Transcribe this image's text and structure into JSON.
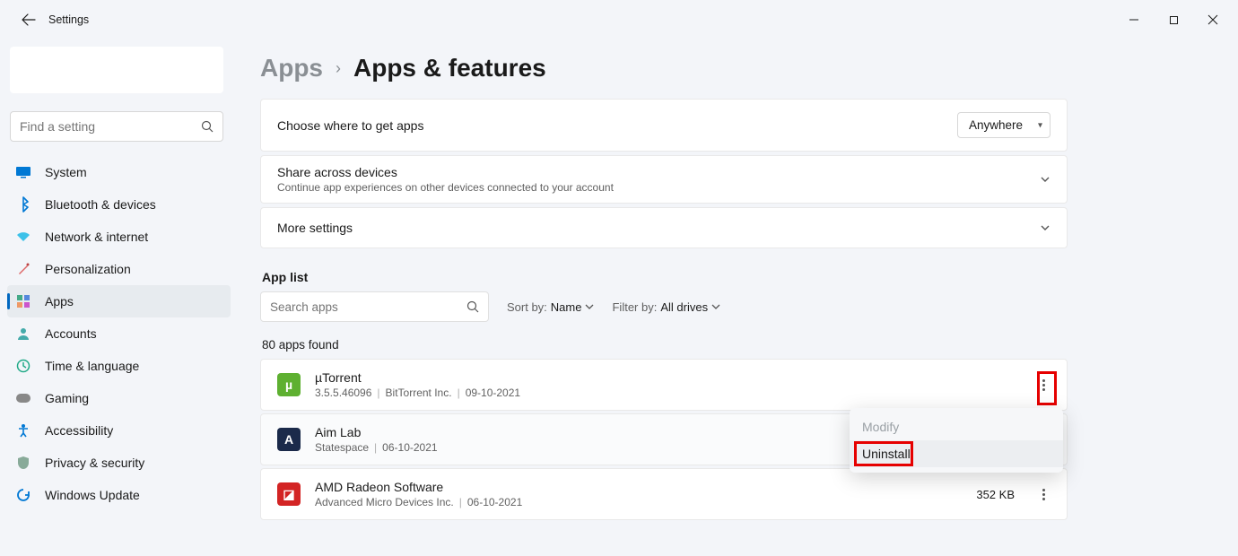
{
  "titlebar": {
    "title": "Settings"
  },
  "search": {
    "placeholder": "Find a setting"
  },
  "nav": [
    {
      "label": "System"
    },
    {
      "label": "Bluetooth & devices"
    },
    {
      "label": "Network & internet"
    },
    {
      "label": "Personalization"
    },
    {
      "label": "Apps"
    },
    {
      "label": "Accounts"
    },
    {
      "label": "Time & language"
    },
    {
      "label": "Gaming"
    },
    {
      "label": "Accessibility"
    },
    {
      "label": "Privacy & security"
    },
    {
      "label": "Windows Update"
    }
  ],
  "breadcrumb": {
    "parent": "Apps",
    "current": "Apps & features"
  },
  "cards": {
    "getApps": {
      "title": "Choose where to get apps",
      "value": "Anywhere"
    },
    "share": {
      "title": "Share across devices",
      "sub": "Continue app experiences on other devices connected to your account"
    },
    "more": {
      "title": "More settings"
    }
  },
  "appList": {
    "label": "App list",
    "searchPlaceholder": "Search apps",
    "sortLabel": "Sort by:",
    "sortValue": "Name",
    "filterLabel": "Filter by:",
    "filterValue": "All drives",
    "count": "80 apps found"
  },
  "apps": [
    {
      "name": "µTorrent",
      "version": "3.5.5.46096",
      "publisher": "BitTorrent Inc.",
      "date": "09-10-2021",
      "size": ""
    },
    {
      "name": "Aim Lab",
      "version": "",
      "publisher": "Statespace",
      "date": "06-10-2021",
      "size": ""
    },
    {
      "name": "AMD Radeon Software",
      "version": "",
      "publisher": "Advanced Micro Devices Inc.",
      "date": "06-10-2021",
      "size": "352 KB"
    }
  ],
  "context": {
    "modify": "Modify",
    "uninstall": "Uninstall"
  }
}
